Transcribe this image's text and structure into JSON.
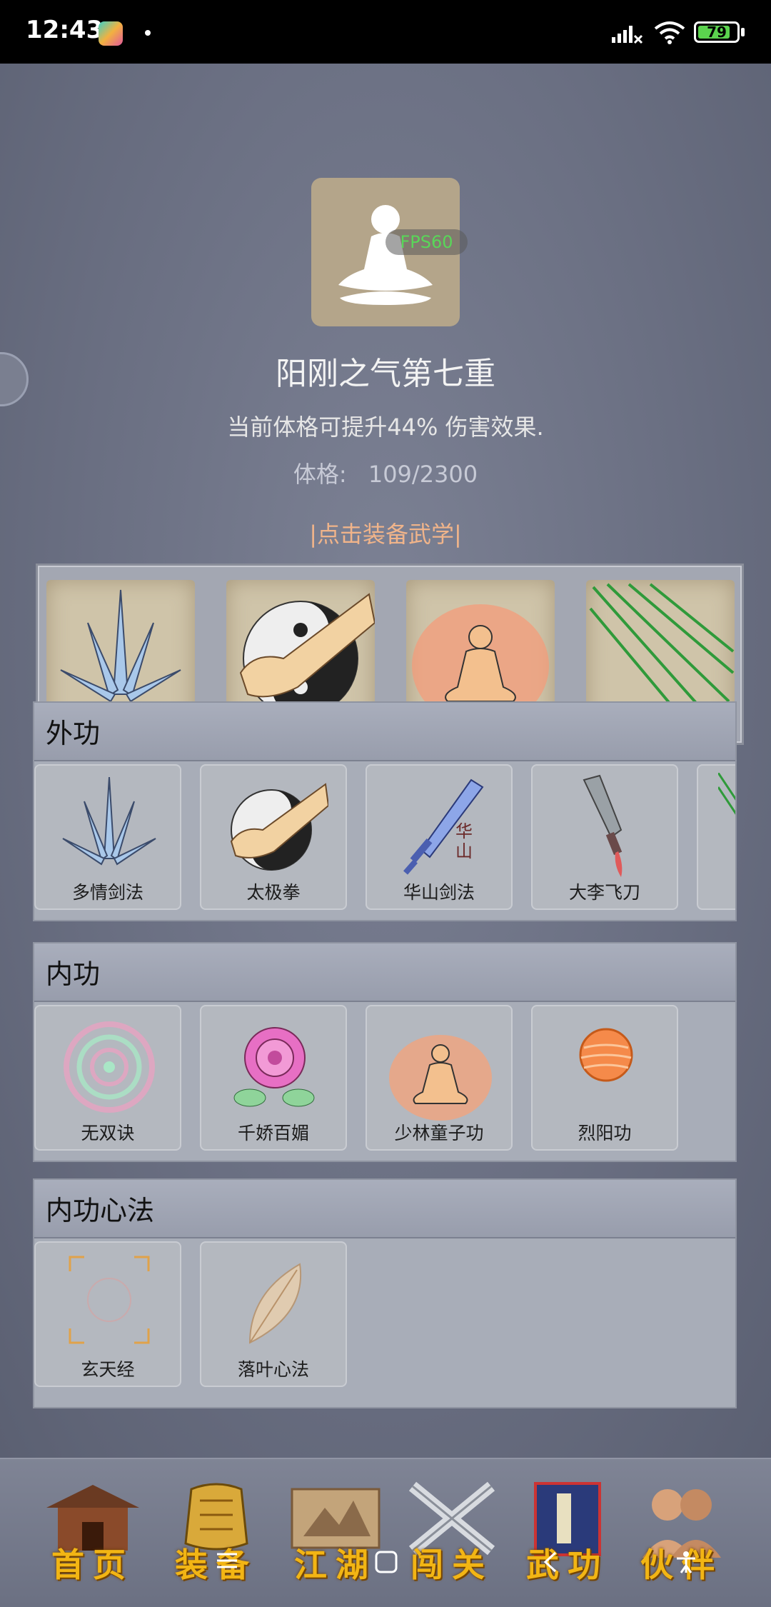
{
  "status_bar": {
    "time": "12:43",
    "battery": "79"
  },
  "portrait": {
    "fps": "FPS60"
  },
  "skill": {
    "title": "阳刚之气第七重",
    "description": "当前体格可提升44% 伤害效果.",
    "stat_label": "体格:",
    "stat_value": "109/2300",
    "equip_hint": "|点击装备武学|"
  },
  "sections": {
    "external": {
      "title": "外功",
      "items": [
        "多情剑法",
        "太极拳",
        "华山剑法",
        "大李飞刀"
      ]
    },
    "internal": {
      "title": "内功",
      "items": [
        "无双诀",
        "千娇百媚",
        "少林童子功",
        "烈阳功"
      ]
    },
    "method": {
      "title": "内功心法",
      "items": [
        "玄天经",
        "落叶心法"
      ]
    }
  },
  "bottom_nav": [
    "首页",
    "装备",
    "江湖",
    "闯关",
    "武功",
    "伙伴"
  ],
  "colors": {
    "accent_orange": "#f0b48a",
    "nav_gold": "#f2b514",
    "fps_green": "#59d659"
  }
}
